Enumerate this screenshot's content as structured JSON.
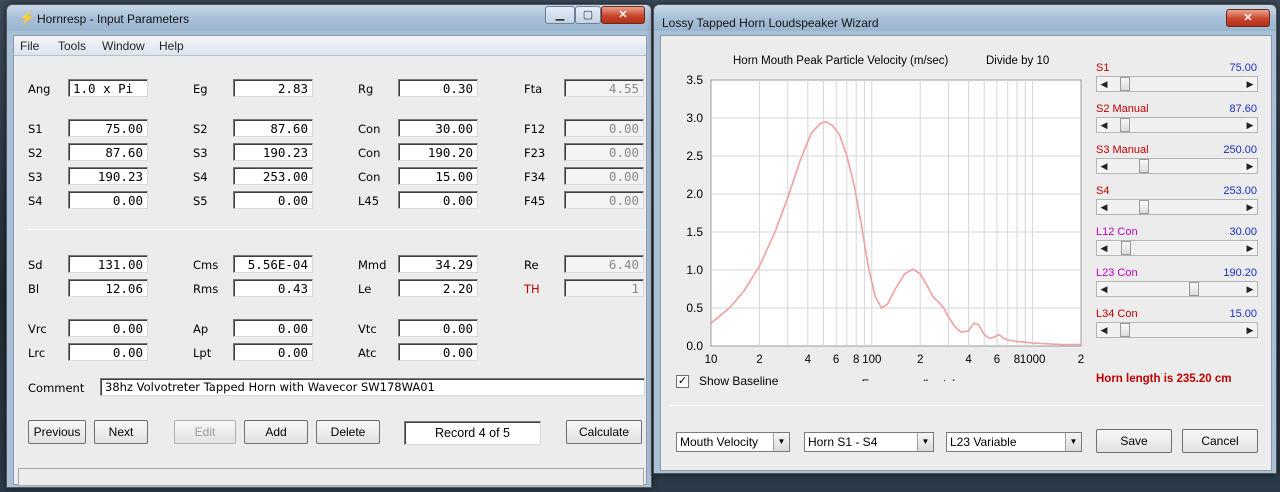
{
  "left_window": {
    "title": "Hornresp - Input Parameters",
    "menu": [
      "File",
      "Tools",
      "Window",
      "Help"
    ],
    "top_fields": [
      {
        "label": "Ang",
        "value": "1.0 x Pi"
      },
      {
        "label": "Eg",
        "value": "2.83"
      },
      {
        "label": "Rg",
        "value": "0.30"
      },
      {
        "label": "Fta",
        "value": "4.55"
      }
    ],
    "horn_rows": [
      [
        {
          "label": "S1",
          "value": "75.00"
        },
        {
          "label": "S2",
          "value": "87.60"
        },
        {
          "label": "Con",
          "value": "30.00"
        },
        {
          "label": "F12",
          "value": "0.00"
        }
      ],
      [
        {
          "label": "S2",
          "value": "87.60"
        },
        {
          "label": "S3",
          "value": "190.23"
        },
        {
          "label": "Con",
          "value": "190.20"
        },
        {
          "label": "F23",
          "value": "0.00"
        }
      ],
      [
        {
          "label": "S3",
          "value": "190.23"
        },
        {
          "label": "S4",
          "value": "253.00"
        },
        {
          "label": "Con",
          "value": "15.00"
        },
        {
          "label": "F34",
          "value": "0.00"
        }
      ],
      [
        {
          "label": "S4",
          "value": "0.00"
        },
        {
          "label": "S5",
          "value": "0.00"
        },
        {
          "label": "L45",
          "value": "0.00"
        },
        {
          "label": "F45",
          "value": "0.00"
        }
      ]
    ],
    "driver_rows": [
      [
        {
          "label": "Sd",
          "value": "131.00"
        },
        {
          "label": "Cms",
          "value": "5.56E-04"
        },
        {
          "label": "Mmd",
          "value": "34.29"
        },
        {
          "label": "Re",
          "value": "6.40"
        }
      ],
      [
        {
          "label": "Bl",
          "value": "12.06"
        },
        {
          "label": "Rms",
          "value": "0.43"
        },
        {
          "label": "Le",
          "value": "2.20"
        },
        {
          "label": "TH",
          "value": "1"
        }
      ]
    ],
    "chamber_rows": [
      [
        {
          "label": "Vrc",
          "value": "0.00"
        },
        {
          "label": "Ap",
          "value": "0.00"
        },
        {
          "label": "Vtc",
          "value": "0.00"
        }
      ],
      [
        {
          "label": "Lrc",
          "value": "0.00"
        },
        {
          "label": "Lpt",
          "value": "0.00"
        },
        {
          "label": "Atc",
          "value": "0.00"
        }
      ]
    ],
    "comment_label": "Comment",
    "comment_value": "38hz Volvotreter Tapped Horn with Wavecor SW178WA01",
    "buttons": {
      "previous": "Previous",
      "next": "Next",
      "edit": "Edit",
      "add": "Add",
      "delete": "Delete",
      "record": "Record 4 of 5",
      "calculate": "Calculate"
    },
    "colors": {
      "th_label": "#c00000"
    }
  },
  "right_window": {
    "title": "Lossy Tapped Horn Loudspeaker Wizard",
    "sliders": [
      {
        "label": "S1",
        "value": "75.00",
        "color": "#c00000",
        "position": 0.07
      },
      {
        "label": "S2 Manual",
        "value": "87.60",
        "color": "#c00000",
        "position": 0.07
      },
      {
        "label": "S3 Manual",
        "value": "250.00",
        "color": "#c00000",
        "position": 0.23
      },
      {
        "label": "S4",
        "value": "253.00",
        "color": "#c00000",
        "position": 0.23
      },
      {
        "label": "L12 Con",
        "value": "30.00",
        "color": "#c000c0",
        "position": 0.08
      },
      {
        "label": "L23 Con",
        "value": "190.20",
        "color": "#c000c0",
        "position": 0.64
      },
      {
        "label": "L34 Con",
        "value": "15.00",
        "color": "#c00000",
        "position": 0.07
      }
    ],
    "horn_length": "Horn length is 235.20 cm",
    "show_baseline": {
      "label": "Show Baseline",
      "checked": true,
      "check_glyph": "✓"
    },
    "dropdowns": [
      "Mouth Velocity",
      "Horn S1 - S4",
      "L23 Variable"
    ],
    "save": "Save",
    "cancel": "Cancel"
  },
  "chart_data": {
    "type": "line",
    "title": "Horn Mouth Peak Particle Velocity (m/sec)",
    "title_note": "Divide by 10",
    "xlabel": "Frequency (hertz)",
    "ylabel": "",
    "xscale": "log",
    "xlim": [
      10,
      2000
    ],
    "ylim": [
      0,
      3.5
    ],
    "yticks": [
      "0.0",
      "0.5",
      "1.0",
      "1.5",
      "2.0",
      "2.5",
      "3.0",
      "3.5"
    ],
    "xtick_labels": [
      {
        "x": 10,
        "label": "10"
      },
      {
        "x": 20,
        "label": "2"
      },
      {
        "x": 40,
        "label": "4"
      },
      {
        "x": 60,
        "label": "6"
      },
      {
        "x": 80,
        "label": "8"
      },
      {
        "x": 100,
        "label": "100"
      },
      {
        "x": 200,
        "label": "2"
      },
      {
        "x": 400,
        "label": "4"
      },
      {
        "x": 600,
        "label": "6"
      },
      {
        "x": 800,
        "label": "8"
      },
      {
        "x": 1000,
        "label": "1000"
      },
      {
        "x": 2000,
        "label": "2"
      }
    ],
    "grid": true,
    "color": "#f0a0a0",
    "series": [
      {
        "x": [
          10,
          13,
          16,
          20,
          25,
          30,
          36,
          42,
          48,
          52,
          57,
          63,
          70,
          78,
          86,
          95,
          105,
          115,
          125,
          140,
          160,
          180,
          200,
          220,
          240,
          260,
          280,
          300,
          330,
          360,
          400,
          430,
          460,
          500,
          540,
          580,
          620,
          660,
          700,
          800,
          900,
          1000,
          1200,
          1500,
          2000
        ],
        "y": [
          0.3,
          0.5,
          0.72,
          1.05,
          1.5,
          1.95,
          2.45,
          2.8,
          2.93,
          2.95,
          2.9,
          2.78,
          2.5,
          2.1,
          1.6,
          1.05,
          0.65,
          0.5,
          0.55,
          0.75,
          0.95,
          1.01,
          0.95,
          0.8,
          0.65,
          0.58,
          0.5,
          0.38,
          0.25,
          0.18,
          0.2,
          0.3,
          0.28,
          0.15,
          0.1,
          0.12,
          0.15,
          0.1,
          0.08,
          0.06,
          0.05,
          0.04,
          0.03,
          0.02,
          0.02
        ]
      }
    ]
  }
}
